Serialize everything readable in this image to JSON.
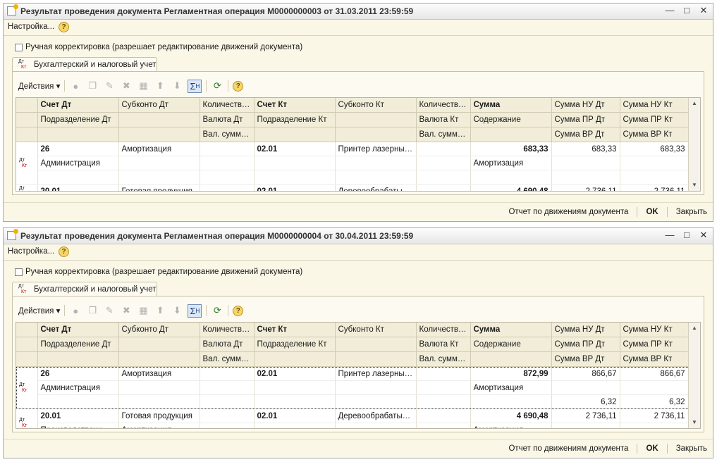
{
  "windows": [
    {
      "title": "Результат проведения документа Регламентная операция М0000000003 от 31.03.2011 23:59:59",
      "setup_label": "Настройка...",
      "manual_label": "Ручная корректировка (разрешает редактирование движений документа)",
      "tab_label": "Бухгалтерский и налоговый учет",
      "actions_label": "Действия",
      "header": {
        "row1": [
          "Счет Дт",
          "Субконто Дт",
          "Количество...",
          "Счет Кт",
          "Субконто Кт",
          "Количество...",
          "Сумма",
          "Сумма НУ Дт",
          "Сумма НУ Кт"
        ],
        "row2": [
          "Подразделение Дт",
          "",
          "Валюта Дт",
          "Подразделение Кт",
          "",
          "Валюта Кт",
          "Содержание",
          "Сумма ПР Дт",
          "Сумма ПР Кт"
        ],
        "row3": [
          "",
          "",
          "Вал. сумма...",
          "",
          "",
          "Вал. сумма...",
          "",
          "Сумма ВР Дт",
          "Сумма ВР Кт"
        ]
      },
      "records": [
        {
          "row1": [
            "26",
            "Амортизация",
            "",
            "02.01",
            "Принтер лазерный...",
            "",
            "683,33",
            "683,33",
            "683,33"
          ],
          "row2": [
            "Администрация",
            "",
            "",
            "",
            "",
            "",
            "Амортизация",
            "",
            ""
          ],
          "row3": [
            "",
            "",
            "",
            "",
            "",
            "",
            "",
            "",
            ""
          ]
        },
        {
          "row1": [
            "20.01",
            "Готовая продукция",
            "",
            "02.01",
            "Деревообрабатыв...",
            "",
            "4 690,48",
            "2 736,11",
            "2 736,11"
          ]
        }
      ],
      "footer": {
        "report": "Отчет по движениям документа",
        "ok": "OK",
        "close": "Закрыть"
      }
    },
    {
      "title": "Результат проведения документа Регламентная операция М0000000004 от 30.04.2011 23:59:59",
      "setup_label": "Настройка...",
      "manual_label": "Ручная корректировка (разрешает редактирование движений документа)",
      "tab_label": "Бухгалтерский и налоговый учет",
      "actions_label": "Действия",
      "header": {
        "row1": [
          "Счет Дт",
          "Субконто Дт",
          "Количество...",
          "Счет Кт",
          "Субконто Кт",
          "Количество...",
          "Сумма",
          "Сумма НУ Дт",
          "Сумма НУ Кт"
        ],
        "row2": [
          "Подразделение Дт",
          "",
          "Валюта Дт",
          "Подразделение Кт",
          "",
          "Валюта Кт",
          "Содержание",
          "Сумма ПР Дт",
          "Сумма ПР Кт"
        ],
        "row3": [
          "",
          "",
          "Вал. сумма...",
          "",
          "",
          "Вал. сумма...",
          "",
          "Сумма ВР Дт",
          "Сумма ВР Кт"
        ]
      },
      "records": [
        {
          "row1": [
            "26",
            "Амортизация",
            "",
            "02.01",
            "Принтер лазерный...",
            "",
            "872,99",
            "866,67",
            "866,67"
          ],
          "row2": [
            "Администрация",
            "",
            "",
            "",
            "",
            "",
            "Амортизация",
            "",
            ""
          ],
          "row3": [
            "",
            "",
            "",
            "",
            "",
            "",
            "",
            "6,32",
            "6,32"
          ]
        },
        {
          "row1": [
            "20.01",
            "Готовая продукция",
            "",
            "02.01",
            "Деревообрабатыв...",
            "",
            "4 690,48",
            "2 736,11",
            "2 736,11"
          ],
          "row2": [
            "Производственный...",
            "Амортизация",
            "",
            "",
            "",
            "",
            "Амортизация",
            "",
            ""
          ]
        }
      ],
      "footer": {
        "report": "Отчет по движениям документа",
        "ok": "OK",
        "close": "Закрыть"
      }
    }
  ],
  "icons": {
    "window": "document-edit-icon",
    "help": "help-icon",
    "record": "dt-kt-icon",
    "sigma": "sigma-totals-icon",
    "refresh": "refresh-icon"
  }
}
